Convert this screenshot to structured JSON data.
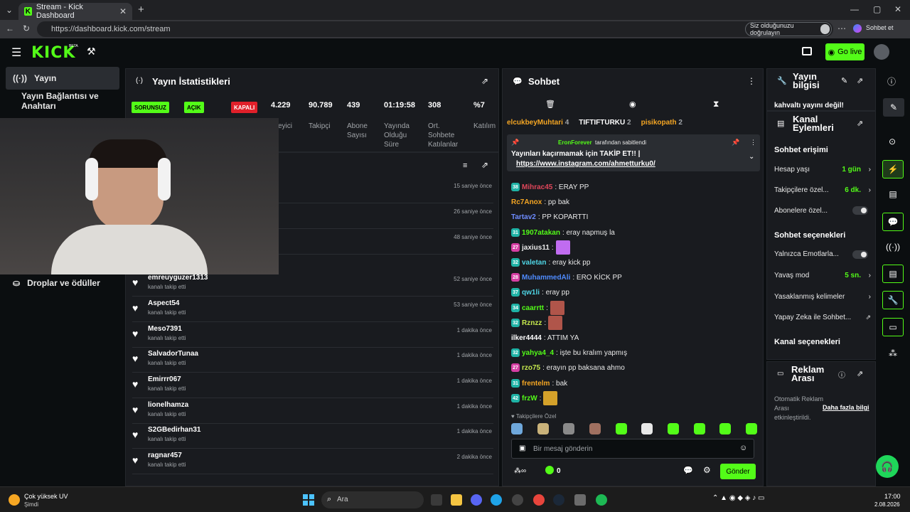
{
  "browser": {
    "tab_title": "Stream - Kick Dashboard",
    "url": "https://dashboard.kick.com/stream",
    "verify_text": "Siz olduğunuzu doğrulayın",
    "chat_link": "Sohbet et"
  },
  "header": {
    "logo": "KICK",
    "logo_sup": "BETA",
    "go_live": "Go live"
  },
  "sidebar": {
    "items": [
      {
        "label": "Yayın"
      },
      {
        "label": "Yayın Bağlantısı ve Anahtarı"
      },
      {
        "label": "Droplar ve ödüller"
      }
    ]
  },
  "stats": {
    "title": "Yayın İstatistikleri",
    "status_pills": [
      "SORUNSUZ",
      "AÇIK",
      "KAPALI"
    ],
    "cells": [
      {
        "value": "4.229",
        "label": "İzleyici"
      },
      {
        "value": "90.789",
        "label": "Takipçi"
      },
      {
        "value": "439",
        "label": "Abone Sayısı"
      },
      {
        "value": "01:19:58",
        "label": "Yayında Olduğu Süre"
      },
      {
        "value": "308",
        "label": "Ort. Sohbete Katılanlar"
      },
      {
        "value": "%7",
        "label": "Katılım"
      }
    ]
  },
  "activity": {
    "items": [
      {
        "name": "",
        "sub": "",
        "time": "15 saniye önce"
      },
      {
        "name": "",
        "sub": "",
        "time": "26 saniye önce"
      },
      {
        "name": "",
        "sub": "",
        "time": "48 saniye önce"
      },
      {
        "name": "emreuyguzer1313",
        "sub": "kanalı takip etti",
        "time": "52 saniye önce"
      },
      {
        "name": "Aspect54",
        "sub": "kanalı takip etti",
        "time": "53 saniye önce"
      },
      {
        "name": "Meso7391",
        "sub": "kanalı takip etti",
        "time": "1 dakika önce"
      },
      {
        "name": "SalvadorTunaa",
        "sub": "kanalı takip etti",
        "time": "1 dakika önce"
      },
      {
        "name": "Emirrr067",
        "sub": "kanalı takip etti",
        "time": "1 dakika önce"
      },
      {
        "name": "lionelhamza",
        "sub": "kanalı takip etti",
        "time": "1 dakika önce"
      },
      {
        "name": "S2GBedirhan31",
        "sub": "kanalı takip etti",
        "time": "1 dakika önce"
      },
      {
        "name": "ragnar457",
        "sub": "kanalı takip etti",
        "time": "2 dakika önce"
      }
    ]
  },
  "chat": {
    "title": "Sohbet",
    "gifters": [
      {
        "name": "elcukbeyMuhtari",
        "count": "4"
      },
      {
        "name": "TIFTIFTURKU",
        "count": "2"
      },
      {
        "name": "pisikopath",
        "count": "2"
      }
    ],
    "pinned_by": "EronForever",
    "pinned_suffix": "tarafından sabitlendi",
    "pinned_text": "Yayınları kaçırmamak için TAKİP ET!! |",
    "pinned_link": "https://www.instagram.com/ahmetturku0/",
    "messages": [
      {
        "badge": "38",
        "badge_color": "#1fb3a6",
        "user": "Mihrac45",
        "user_color": "#e0465a",
        "text": ": ERAY PP"
      },
      {
        "badge": "",
        "badge_color": "",
        "user": "Rc7Anox",
        "user_color": "#f5a623",
        "text": ": pp bak"
      },
      {
        "badge": "",
        "badge_color": "",
        "user": "Tartav2",
        "user_color": "#6e8cff",
        "text": ": PP KOPARTTI"
      },
      {
        "badge": "31",
        "badge_color": "#1fb3a6",
        "user": "1907atakan",
        "user_color": "#53fc18",
        "text": ": eray napmuş la"
      },
      {
        "badge": "27",
        "badge_color": "#d63ea3",
        "user": "jaxius11",
        "user_color": "#e8e8e8",
        "text": ":"
      },
      {
        "badge": "32",
        "badge_color": "#1fb3a6",
        "user": "valetan",
        "user_color": "#4fd6e6",
        "text": ": eray kick pp"
      },
      {
        "badge": "28",
        "badge_color": "#d63ea3",
        "user": "MuhammedAli",
        "user_color": "#4f8cff",
        "text": ": ERO KİCK PP"
      },
      {
        "badge": "37",
        "badge_color": "#1fb3a6",
        "user": "qw1li",
        "user_color": "#4fd6e6",
        "text": ": eray pp"
      },
      {
        "badge": "34",
        "badge_color": "#1fb3a6",
        "user": "caarrtt",
        "user_color": "#53fc18",
        "text": ":"
      },
      {
        "badge": "32",
        "badge_color": "#1fb3a6",
        "user": "Rznzz",
        "user_color": "#c5e84d",
        "text": ":"
      },
      {
        "badge": "",
        "badge_color": "",
        "user": "ilker4444",
        "user_color": "#ffffff",
        "text": ": ATTIM YA"
      },
      {
        "badge": "32",
        "badge_color": "#1fb3a6",
        "user": "yahya4_4",
        "user_color": "#53fc18",
        "text": ": işte bu kralım yapmış"
      },
      {
        "badge": "27",
        "badge_color": "#d63ea3",
        "user": "rzo75",
        "user_color": "#c5e84d",
        "text": ": erayın pp baksana ahmo"
      },
      {
        "badge": "31",
        "badge_color": "#1fb3a6",
        "user": "frentelm",
        "user_color": "#f5a623",
        "text": ": bak"
      },
      {
        "badge": "42",
        "badge_color": "#1fb3a6",
        "user": "frzW",
        "user_color": "#53fc18",
        "text": ":"
      }
    ],
    "emote_section": "Takipçilere Özel",
    "input_placeholder": "Bir mesaj gönderin",
    "points": "0",
    "send": "Gönder"
  },
  "info": {
    "title": "Yayın bilgisi",
    "stream_title": "kahvaltı yayını değil!",
    "actions_title": "Kanal Eylemleri",
    "chat_access": "Sohbet erişimi",
    "rows_access": [
      {
        "label": "Hesap yaşı",
        "value": "1 gün"
      },
      {
        "label": "Takipçilere özel...",
        "value": "6 dk."
      },
      {
        "label": "Abonelere özel...",
        "value": ""
      }
    ],
    "chat_options": "Sohbet seçenekleri",
    "rows_options": [
      {
        "label": "Yalnızca Emotlarla...",
        "value": ""
      },
      {
        "label": "Yavaş mod",
        "value": "5 sn."
      },
      {
        "label": "Yasaklanmış kelimeler",
        "value": ""
      },
      {
        "label": "Yapay Zeka ile Sohbet...",
        "value": ""
      }
    ],
    "channel_options": "Kanal seçenekleri",
    "ad_title": "Reklam Arası",
    "ad_text": "Otomatik Reklam Arası etkinleştirildi.",
    "ad_link": "Daha fazla bilgi"
  },
  "taskbar": {
    "weather": "Çok yüksek UV",
    "weather_sub": "Şimdi",
    "search": "Ara",
    "time": "17:00",
    "date": "2.08.2026"
  },
  "colors": {
    "accent": "#53fc18",
    "panel": "#191b1f",
    "bg": "#0b0e10"
  }
}
